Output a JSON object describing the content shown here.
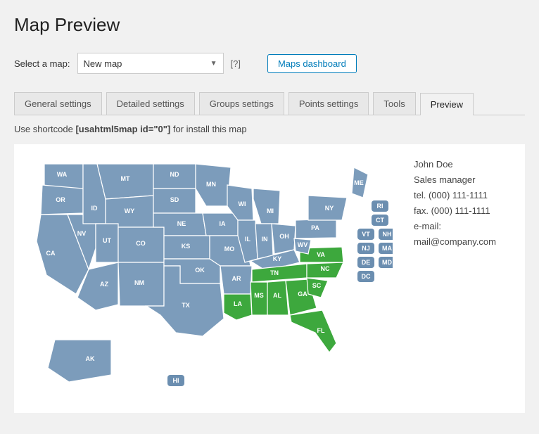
{
  "title": "Map Preview",
  "select_label": "Select a map:",
  "dropdown_value": "New map",
  "help": "[?]",
  "dashboard_btn": "Maps dashboard",
  "tabs": [
    "General settings",
    "Detailed settings",
    "Groups settings",
    "Points settings",
    "Tools",
    "Preview"
  ],
  "active_tab": "Preview",
  "shortcode_prefix": "Use shortcode ",
  "shortcode_code": "[usahtml5map id=\"0\"]",
  "shortcode_suffix": " for install this map",
  "info": {
    "name": "John Doe",
    "role": "Sales manager",
    "tel": "tel. (000) 111-1111",
    "fax": "fax. (000) 111-1111",
    "email": "e-mail: mail@company.com"
  },
  "green_states": [
    "LA",
    "MS",
    "AL",
    "GA",
    "FL",
    "SC",
    "NC",
    "TN",
    "VA"
  ],
  "map_states": {
    "WA": "Washington",
    "OR": "Oregon",
    "CA": "California",
    "NV": "Nevada",
    "ID": "Idaho",
    "MT": "Montana",
    "WY": "Wyoming",
    "UT": "Utah",
    "AZ": "Arizona",
    "NM": "New Mexico",
    "CO": "Colorado",
    "ND": "North Dakota",
    "SD": "South Dakota",
    "NE": "Nebraska",
    "KS": "Kansas",
    "OK": "Oklahoma",
    "TX": "Texas",
    "MN": "Minnesota",
    "IA": "Iowa",
    "MO": "Missouri",
    "AR": "Arkansas",
    "LA": "Louisiana",
    "WI": "Wisconsin",
    "IL": "Illinois",
    "MI": "Michigan",
    "IN": "Indiana",
    "OH": "Ohio",
    "KY": "Kentucky",
    "TN": "Tennessee",
    "MS": "Mississippi",
    "AL": "Alabama",
    "GA": "Georgia",
    "FL": "Florida",
    "SC": "South Carolina",
    "NC": "North Carolina",
    "VA": "Virginia",
    "WV": "West Virginia",
    "PA": "Pennsylvania",
    "NY": "New York",
    "ME": "Maine",
    "AK": "Alaska",
    "HI": "Hawaii"
  },
  "pill_states": [
    "RI",
    "CT",
    "VT",
    "NH",
    "NJ",
    "MA",
    "DE",
    "MD",
    "DC"
  ]
}
